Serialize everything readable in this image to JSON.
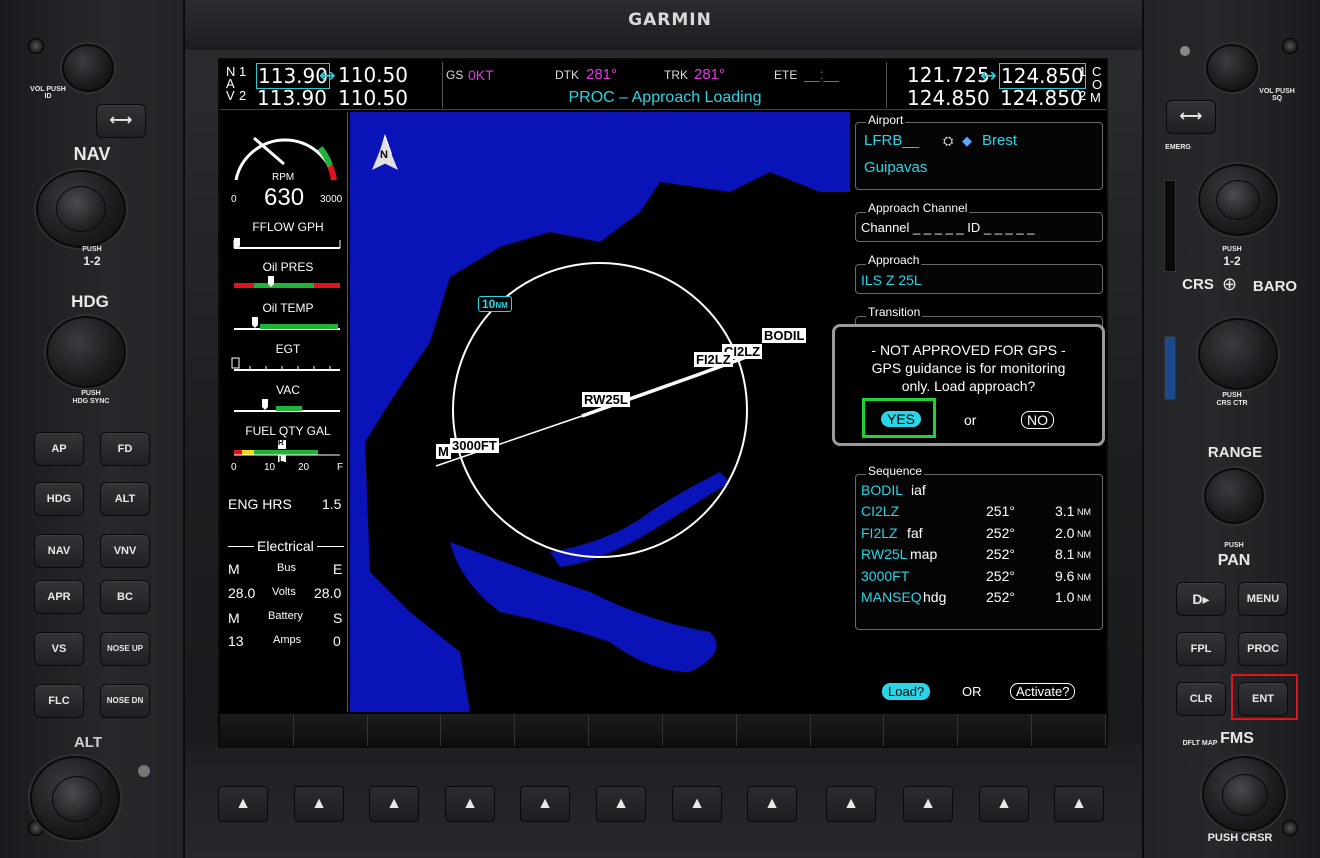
{
  "brand": "GARMIN",
  "nav": {
    "label_n": "N",
    "label_a": "A",
    "label_v": "V",
    "num_1": "1",
    "num_2": "2",
    "nav1_active": "113.90",
    "nav1_standby": "110.50",
    "nav2_active": "113.90",
    "nav2_standby": "110.50",
    "swap": "↔"
  },
  "com": {
    "com1_standby": "121.725",
    "com1_active": "124.850",
    "com2_standby": "124.850",
    "com2_active": "124.850",
    "label_c": "C",
    "label_o": "O",
    "label_m": "M",
    "num_1": "1",
    "num_2": "2",
    "swap": "↔"
  },
  "status": {
    "gs_label": "GS",
    "gs_value": "0KT",
    "dtk_label": "DTK",
    "dtk_value": "281°",
    "trk_label": "TRK",
    "trk_value": "281°",
    "ete_label": "ETE",
    "ete_value": "__:__",
    "message": "PROC – Approach Loading"
  },
  "eis": {
    "rpm_label": "RPM",
    "rpm_value": "630",
    "rpm_min": "0",
    "rpm_max": "3000",
    "fflow": "FFLOW GPH",
    "oil_pres": "Oil PRES",
    "oil_temp": "Oil TEMP",
    "egt": "EGT",
    "vac": "VAC",
    "fuel_qty": "FUEL QTY GAL",
    "fuel_marks": [
      "0",
      "10",
      "20",
      "F"
    ],
    "fuel_r": "R",
    "fuel_l": "L",
    "eng_hrs_label": "ENG HRS",
    "eng_hrs_value": "1.5",
    "electrical": "Electrical",
    "bus_left": "M",
    "bus_label": "Bus",
    "bus_right": "E",
    "volts_left": "28.0",
    "volts_label": "Volts",
    "volts_right": "28.0",
    "battery_left": "M",
    "battery_label": "Battery",
    "battery_right": "S",
    "amps_left": "13",
    "amps_label": "Amps",
    "amps_right": "0"
  },
  "map": {
    "north": "N",
    "range": "10",
    "range_unit": "NM",
    "waypoints": {
      "bodil": "BODIL",
      "ci2lz": "CI2LZ",
      "fi2lz": "FI2LZ",
      "rw25l": "RW25L",
      "ft3000": "3000FT",
      "m": "M"
    }
  },
  "panel": {
    "airport_title": "Airport",
    "airport_id": "LFRB__",
    "airport_city": "Brest",
    "airport_name": "Guipavas",
    "channel_title": "Approach Channel",
    "channel_text": "Channel _ _ _ _ _ ID _ _ _ _ _",
    "approach_title": "Approach",
    "approach_value": "ILS Z 25L",
    "transition_title": "Transition",
    "sequence_title": "Sequence",
    "sequence": [
      {
        "wpt": "BODIL",
        "tag": "iaf",
        "crs": "",
        "dist": "",
        "unit": ""
      },
      {
        "wpt": "CI2LZ",
        "tag": "",
        "crs": "251°",
        "dist": "3.1",
        "unit": "NM"
      },
      {
        "wpt": "FI2LZ",
        "tag": "faf",
        "crs": "252°",
        "dist": "2.0",
        "unit": "NM"
      },
      {
        "wpt": "RW25L",
        "tag": "map",
        "crs": "252°",
        "dist": "8.1",
        "unit": "NM"
      },
      {
        "wpt": "3000FT",
        "tag": "",
        "crs": "252°",
        "dist": "9.6",
        "unit": "NM"
      },
      {
        "wpt": "MANSEQ",
        "tag": "hdg",
        "crs": "252°",
        "dist": "1.0",
        "unit": "NM"
      }
    ],
    "load": "Load?",
    "or": "OR",
    "activate": "Activate?"
  },
  "dialog": {
    "line1": "- NOT APPROVED FOR GPS -",
    "line2": "GPS guidance is for monitoring",
    "line3": "only. Load approach?",
    "yes": "YES",
    "or": "or",
    "no": "NO"
  },
  "left_hw": {
    "vol": "VOL",
    "push_id": "PUSH ID",
    "swap": "⟷",
    "nav": "NAV",
    "nav_push": "PUSH",
    "nav_12": "1-2",
    "hdg": "HDG",
    "hdg_push": "PUSH",
    "hdg_sync": "HDG SYNC",
    "ap": "AP",
    "fd": "FD",
    "hdg_btn": "HDG",
    "alt_btn": "ALT",
    "nav_btn": "NAV",
    "vnv": "VNV",
    "apr": "APR",
    "bc": "BC",
    "vs": "VS",
    "nose_up": "NOSE UP",
    "flc": "FLC",
    "nose_dn": "NOSE DN",
    "alt": "ALT"
  },
  "right_hw": {
    "vol": "VOL",
    "push_sq": "PUSH SQ",
    "swap": "⟷",
    "emerg": "EMERG",
    "com_push": "PUSH",
    "com_12": "1-2",
    "crs": "CRS",
    "baro": "BARO",
    "crs_push": "PUSH",
    "crs_ctr": "CRS CTR",
    "range": "RANGE",
    "pan_push": "PUSH",
    "pan": "PAN",
    "direct": "D▸",
    "menu": "MENU",
    "fpl": "FPL",
    "proc": "PROC",
    "clr": "CLR",
    "ent": "ENT",
    "dflt_map": "DFLT MAP",
    "fms": "FMS",
    "push_crsr": "PUSH CRSR"
  },
  "softkey_arrow": "▲"
}
